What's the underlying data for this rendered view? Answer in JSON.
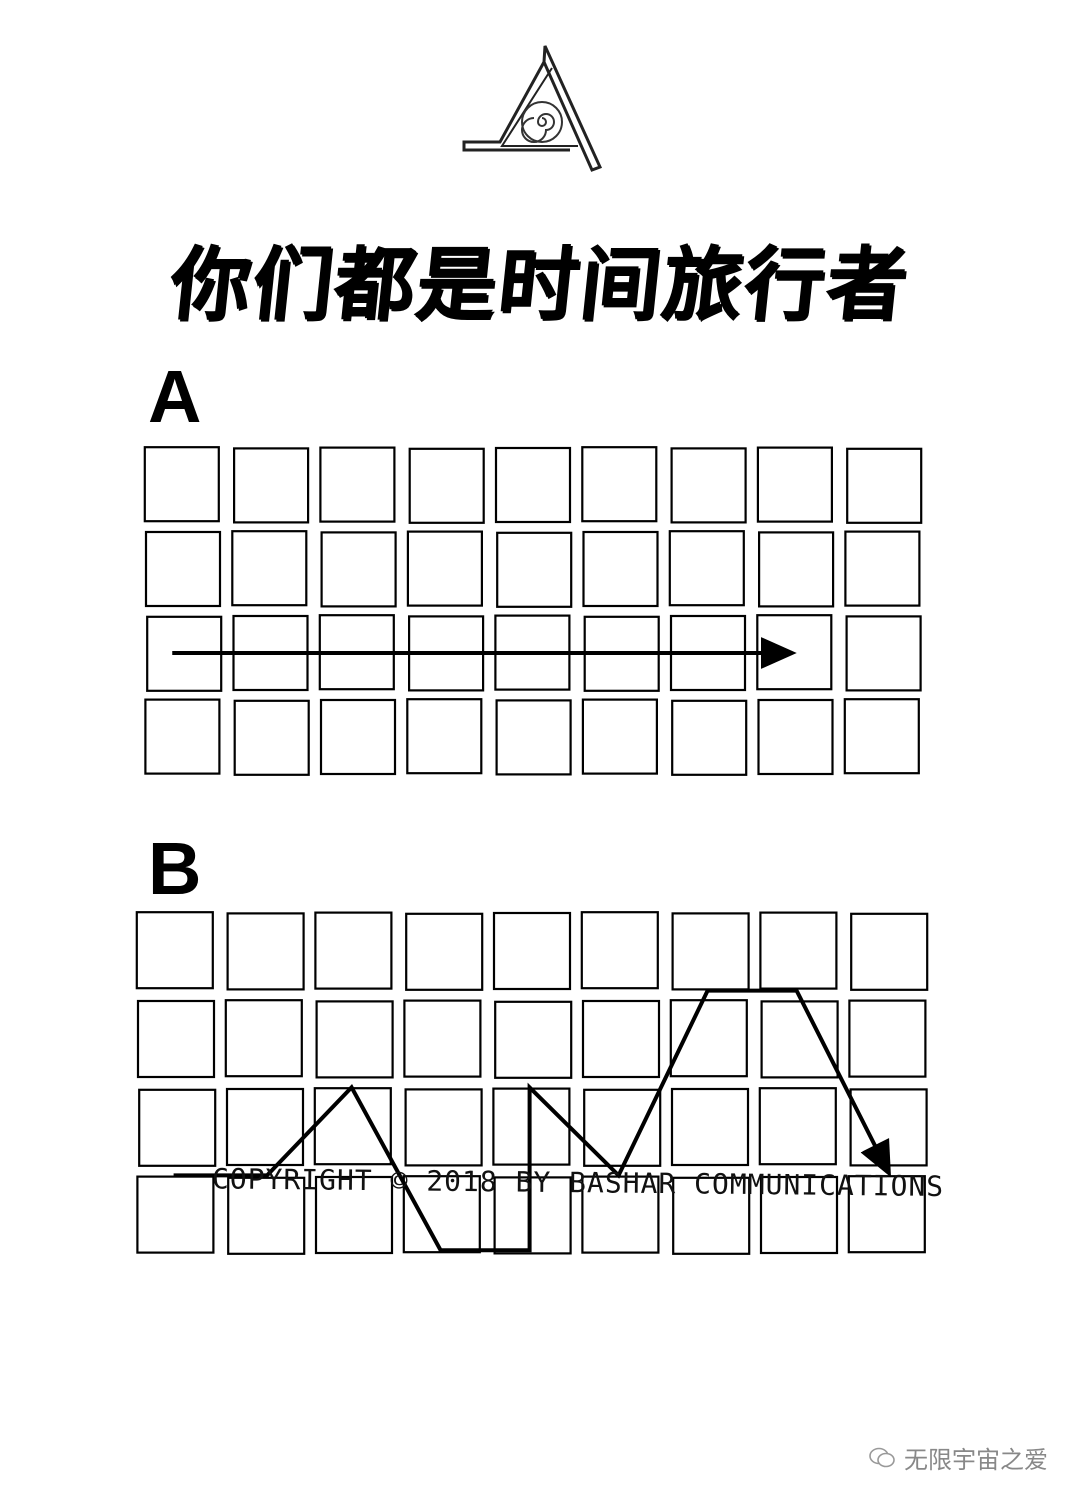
{
  "title": "你们都是时间旅行者",
  "panels": [
    {
      "label": "A",
      "rows": 4,
      "cols": 9,
      "path": [
        [
          0.3,
          2
        ],
        [
          7.3,
          2
        ]
      ]
    },
    {
      "label": "B",
      "rows": 4,
      "cols": 9,
      "path": [
        [
          0.4,
          2.55
        ],
        [
          1.45,
          2.55
        ],
        [
          2.4,
          1.55
        ],
        [
          3.4,
          3.4
        ],
        [
          4.4,
          3.4
        ],
        [
          4.4,
          1.55
        ],
        [
          5.4,
          2.55
        ],
        [
          6.4,
          0.45
        ],
        [
          7.4,
          0.45
        ],
        [
          8.4,
          2.45
        ]
      ]
    }
  ],
  "copyright": "COPYRIGHT © 2018 BY BASHAR COMMUNICATIONS",
  "watermark": "无限宇宙之爱",
  "colors": {
    "ink": "#000000",
    "background": "#ffffff",
    "watermark": "#888888"
  }
}
